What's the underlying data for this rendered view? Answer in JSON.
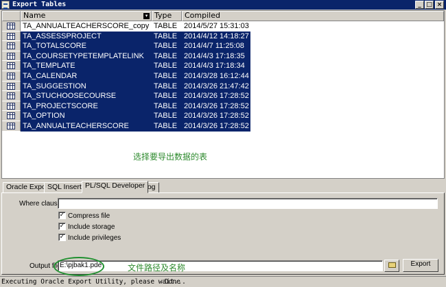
{
  "window": {
    "title": "Export Tables",
    "min_label": "_",
    "max_label": "□",
    "close_label": "×"
  },
  "grid": {
    "columns": [
      "Name",
      "Type",
      "Compiled"
    ],
    "rows": [
      {
        "name": "TA_ANNUALTEACHERSCORE_copy",
        "type": "TABLE",
        "compiled": "2014/5/27 15:31:03",
        "selected": false
      },
      {
        "name": "TA_ASSESSPROJECT",
        "type": "TABLE",
        "compiled": "2014/4/12 14:18:27",
        "selected": true
      },
      {
        "name": "TA_TOTALSCORE",
        "type": "TABLE",
        "compiled": "2014/4/7 11:25:08",
        "selected": true
      },
      {
        "name": "TA_COURSETYPETEMPLATELINK",
        "type": "TABLE",
        "compiled": "2014/4/3 17:18:35",
        "selected": true
      },
      {
        "name": "TA_TEMPLATE",
        "type": "TABLE",
        "compiled": "2014/4/3 17:18:34",
        "selected": true
      },
      {
        "name": "TA_CALENDAR",
        "type": "TABLE",
        "compiled": "2014/3/28 16:12:44",
        "selected": true
      },
      {
        "name": "TA_SUGGESTION",
        "type": "TABLE",
        "compiled": "2014/3/26 21:47:42",
        "selected": true
      },
      {
        "name": "TA_STUCHOOSECOURSE",
        "type": "TABLE",
        "compiled": "2014/3/26 17:28:52",
        "selected": true
      },
      {
        "name": "TA_PROJECTSCORE",
        "type": "TABLE",
        "compiled": "2014/3/26 17:28:52",
        "selected": true
      },
      {
        "name": "TA_OPTION",
        "type": "TABLE",
        "compiled": "2014/3/26 17:28:52",
        "selected": true
      },
      {
        "name": "TA_ANNUALTEACHERSCORE",
        "type": "TABLE",
        "compiled": "2014/3/26 17:28:52",
        "selected": true
      }
    ]
  },
  "annotations": {
    "select_tables": "选择要导出数据的表",
    "file_path": "文件路径及名称"
  },
  "tabs": [
    "Oracle Export",
    "SQL Inserts",
    "PL/SQL Developer",
    "Log"
  ],
  "active_tab": "PL/SQL Developer",
  "options": {
    "where_clause_label": "Where clause",
    "where_clause_value": "",
    "compress_label": "Compress file",
    "compress_checked": true,
    "storage_label": "Include storage",
    "storage_checked": true,
    "privileges_label": "Include privileges",
    "privileges_checked": true
  },
  "output": {
    "label": "Output file",
    "value": "E:\\pjbak1.pde",
    "export_button": "Export"
  },
  "status": {
    "message": "Executing Oracle Export Utility, please wait...",
    "done": "Done"
  },
  "colors": {
    "selection": "#0a246a",
    "annotation": "#2d8a2d"
  }
}
